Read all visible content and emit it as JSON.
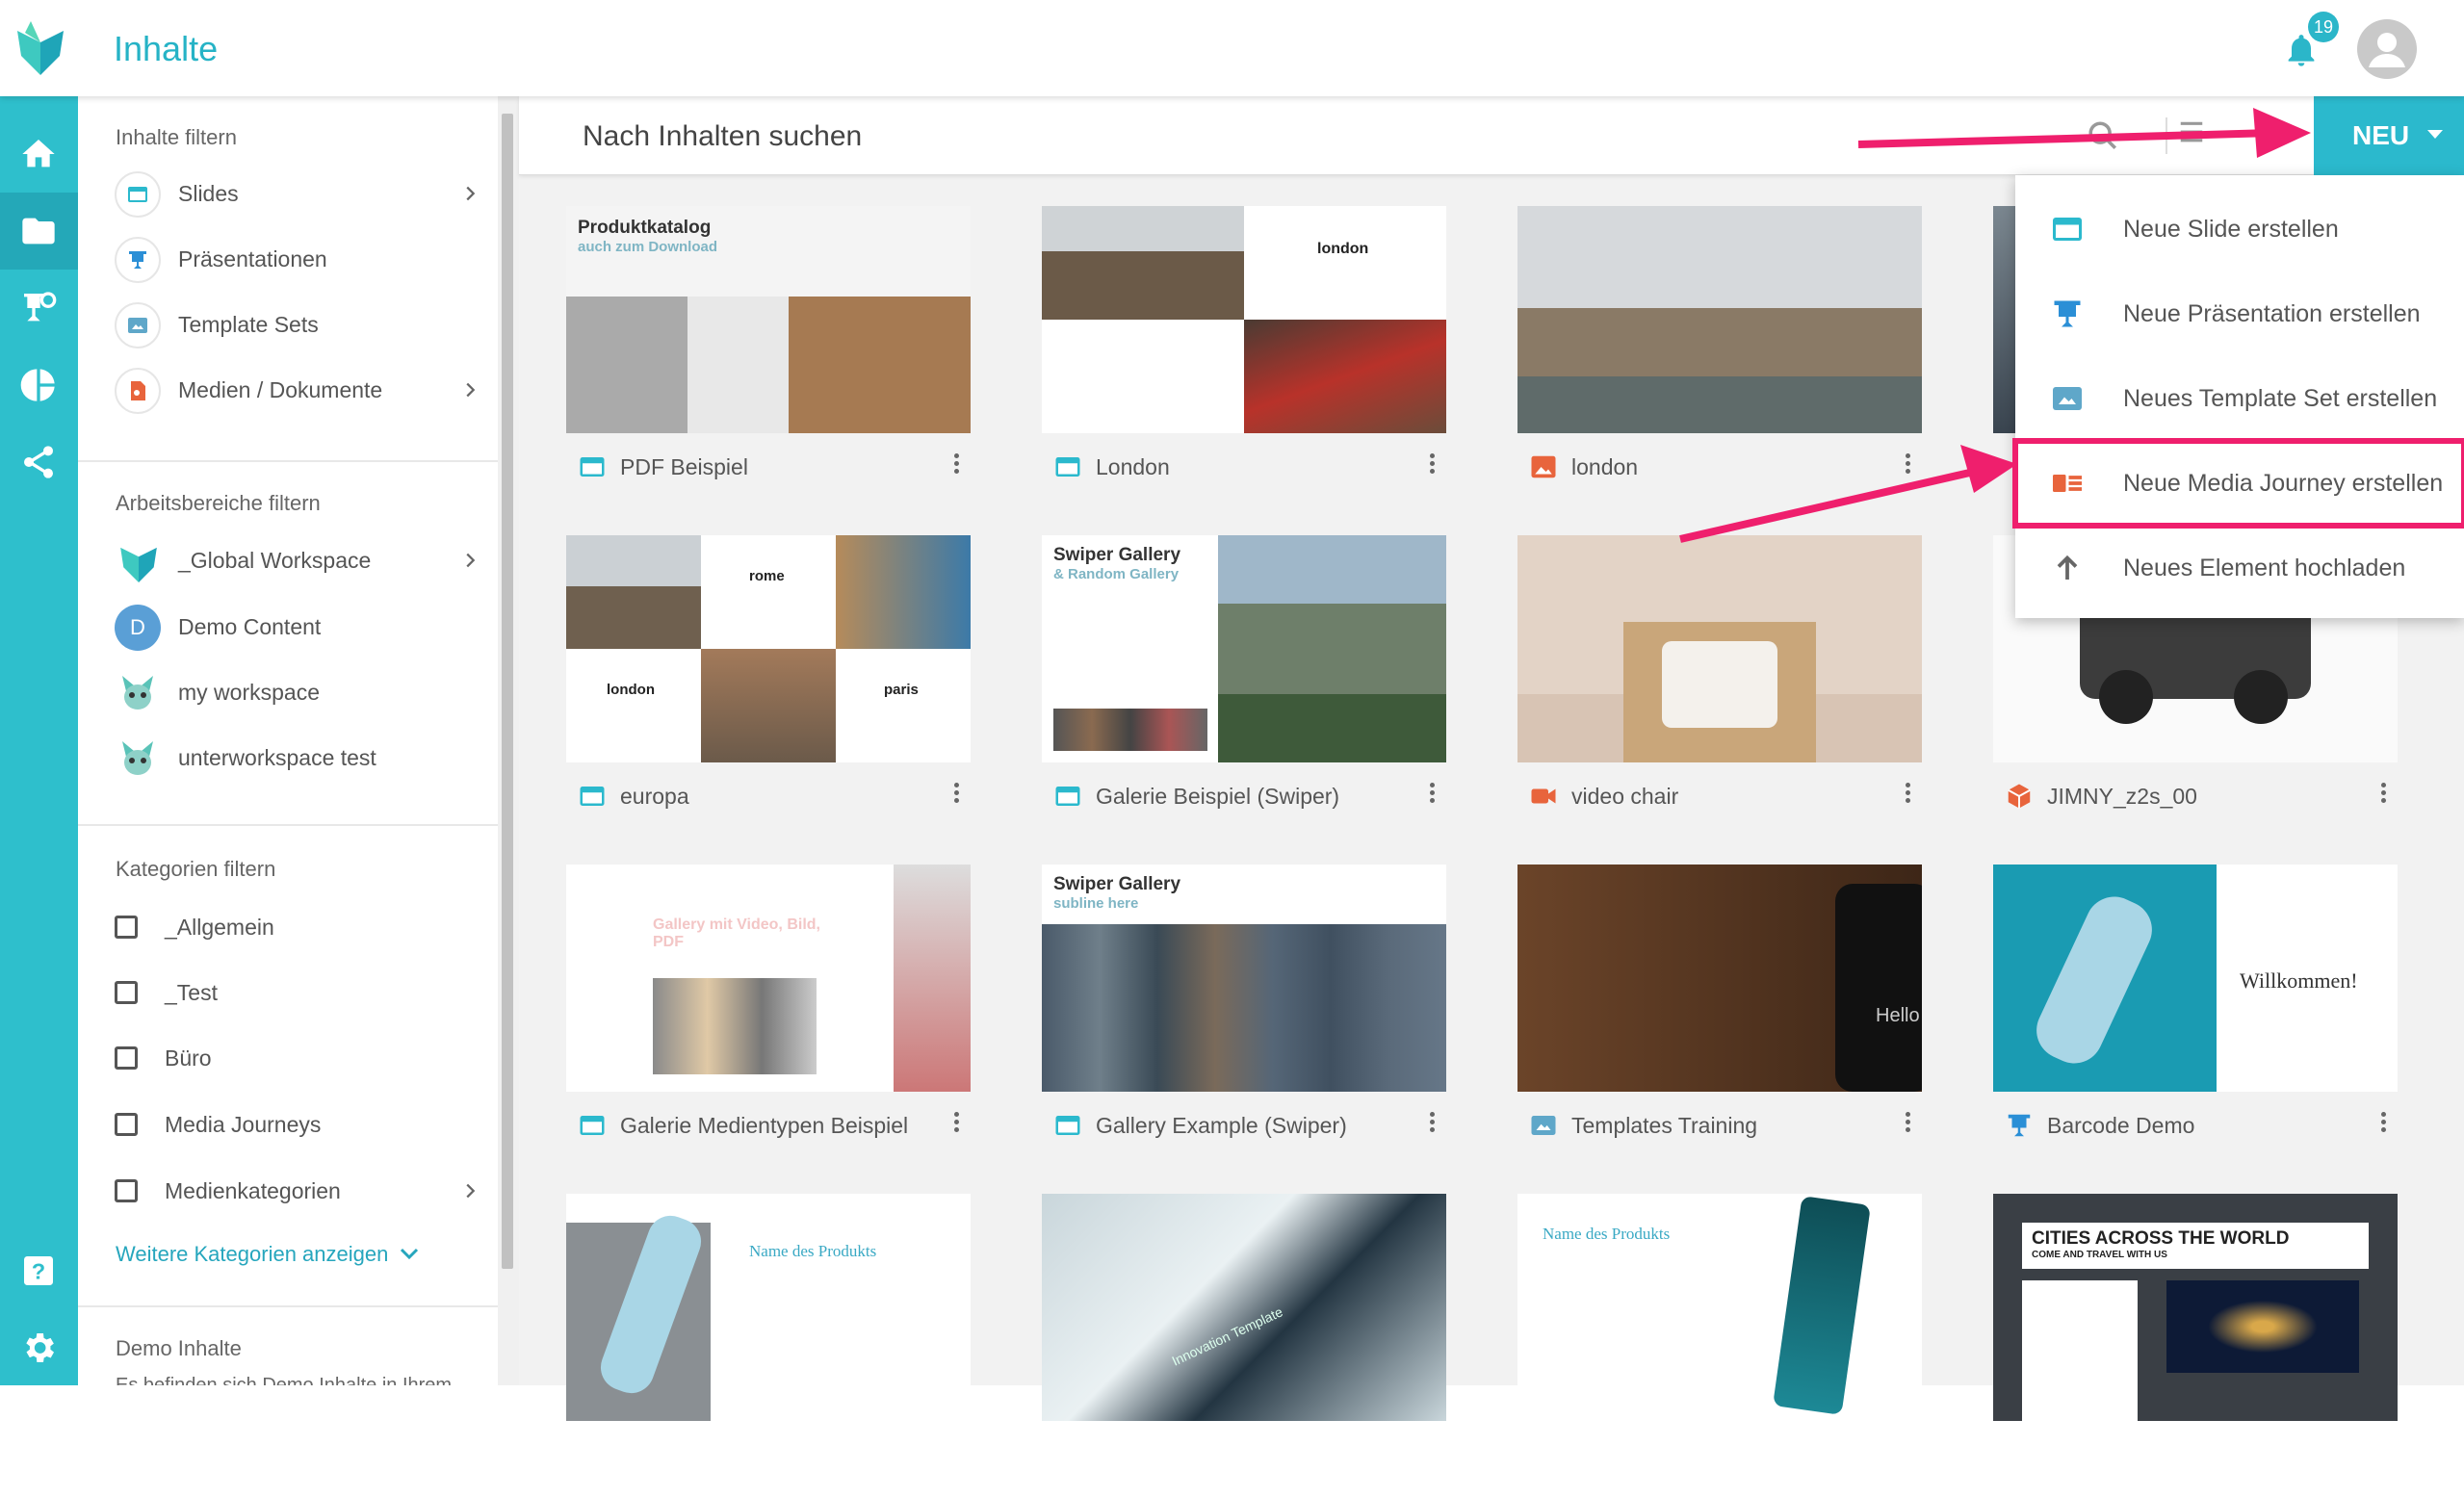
{
  "header": {
    "title": "Inhalte",
    "notification_count": "19"
  },
  "rail": {
    "items": [
      "home-icon",
      "folder-icon",
      "presentation-icon",
      "chart-pie-icon",
      "share-icon",
      "help-icon",
      "settings-icon"
    ],
    "accent": "#2ebfcc"
  },
  "filters": {
    "content_heading": "Inhalte filtern",
    "content_items": [
      {
        "label": "Slides",
        "icon": "slide-icon",
        "has_children": true
      },
      {
        "label": "Präsentationen",
        "icon": "presentation-icon",
        "has_children": false
      },
      {
        "label": "Template Sets",
        "icon": "template-icon",
        "has_children": false
      },
      {
        "label": "Medien / Dokumente",
        "icon": "media-icon",
        "has_children": true
      }
    ],
    "workspace_heading": "Arbeitsbereiche filtern",
    "workspace_items": [
      {
        "label": "_Global Workspace",
        "has_children": true
      },
      {
        "label": "Demo Content",
        "initial": "D"
      },
      {
        "label": "my workspace"
      },
      {
        "label": "unterworkspace test"
      }
    ],
    "category_heading": "Kategorien filtern",
    "category_items": [
      {
        "label": "_Allgemein"
      },
      {
        "label": "_Test"
      },
      {
        "label": "Büro"
      },
      {
        "label": "Media Journeys"
      },
      {
        "label": "Medienkategorien",
        "has_children": true
      }
    ],
    "more_categories": "Weitere Kategorien anzeigen",
    "demo_heading": "Demo Inhalte",
    "demo_text": "Es befinden sich Demo Inhalte in Ihrem"
  },
  "search": {
    "placeholder": "Nach Inhalten suchen"
  },
  "new_button": {
    "label": "NEU"
  },
  "dropdown": {
    "items": [
      {
        "label": "Neue Slide erstellen",
        "icon": "slide-icon"
      },
      {
        "label": "Neue Präsentation erstellen",
        "icon": "presentation-icon"
      },
      {
        "label": "Neues Template Set erstellen",
        "icon": "template-icon"
      },
      {
        "label": "Neue Media Journey erstellen",
        "icon": "media-journey-icon",
        "highlighted": true
      },
      {
        "label": "Neues Element hochladen",
        "icon": "upload-icon"
      }
    ]
  },
  "cards": [
    {
      "title": "PDF Beispiel",
      "type": "slide",
      "thumb_title": "Produktkatalog",
      "thumb_sub": "auch zum Download"
    },
    {
      "title": "London",
      "type": "slide",
      "thumb_title": "london"
    },
    {
      "title": "london",
      "type": "image"
    },
    {
      "title": "",
      "type": "slide"
    },
    {
      "title": "europa",
      "type": "slide",
      "labels": [
        "rome",
        "london",
        "paris"
      ]
    },
    {
      "title": "Galerie Beispiel (Swiper)",
      "type": "slide",
      "thumb_title": "Swiper Gallery",
      "thumb_sub": "& Random Gallery"
    },
    {
      "title": "video chair",
      "type": "video"
    },
    {
      "title": "JIMNY_z2s_00",
      "type": "3d"
    },
    {
      "title": "Galerie Medientypen Beispiel",
      "type": "slide",
      "thumb_title": "Gallery mit Video, Bild, PDF"
    },
    {
      "title": "Gallery Example (Swiper)",
      "type": "slide",
      "thumb_title": "Swiper Gallery",
      "thumb_sub": "subline here"
    },
    {
      "title": "Templates Training",
      "type": "template",
      "thumb_title": "Hello"
    },
    {
      "title": "Barcode Demo",
      "type": "presentation",
      "thumb_title": "Willkommen!"
    },
    {
      "title": "",
      "type": "slide",
      "thumb_title": "Name des Produkts"
    },
    {
      "title": "",
      "type": "slide",
      "thumb_title": "Innovation Template"
    },
    {
      "title": "",
      "type": "slide",
      "thumb_title": "Name des Produkts"
    },
    {
      "title": "",
      "type": "slide",
      "thumb_title": "CITIES ACROSS THE WORLD",
      "thumb_sub": "COME AND TRAVEL WITH US"
    }
  ],
  "colors": {
    "accent": "#2bb9cd",
    "highlight": "#ef1f6d",
    "media_orange": "#e8643c"
  }
}
